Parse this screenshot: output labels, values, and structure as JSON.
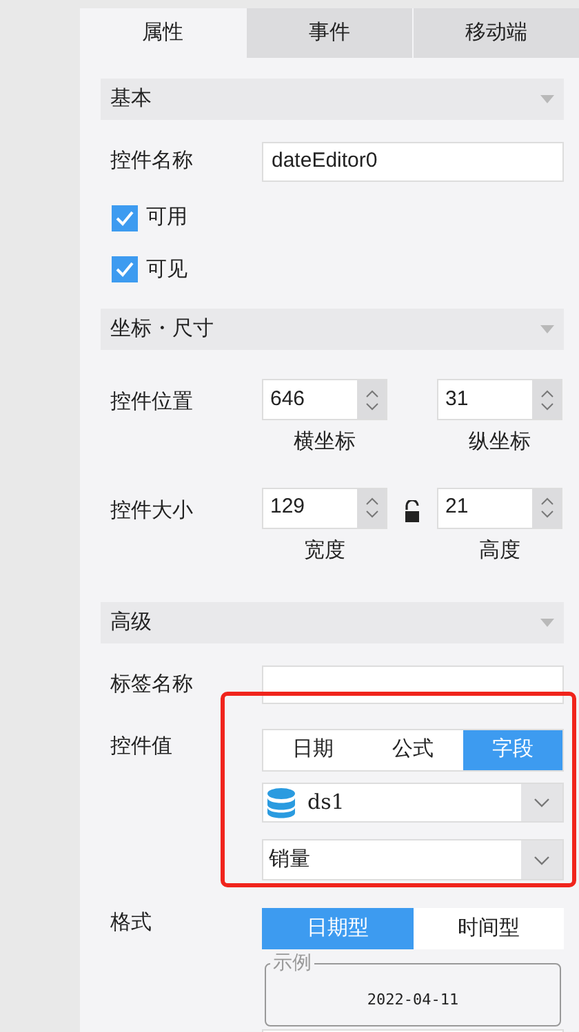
{
  "tabs": [
    {
      "label": "属性",
      "selected": true
    },
    {
      "label": "事件",
      "selected": false
    },
    {
      "label": "移动端",
      "selected": false
    }
  ],
  "basic": {
    "title": "基本",
    "expanded": true,
    "name_label": "控件名称",
    "name_value": "dateEditor0",
    "checkboxes": [
      {
        "label": "可用",
        "checked": true
      },
      {
        "label": "可见",
        "checked": true
      }
    ]
  },
  "geometry": {
    "title": "坐标・尺寸",
    "expanded": true,
    "rows": [
      {
        "label": "控件位置",
        "fields": [
          {
            "value": "646",
            "caption": "横坐标"
          },
          {
            "value": "31",
            "caption": "纵坐标"
          }
        ],
        "lock": false
      },
      {
        "label": "控件大小",
        "fields": [
          {
            "value": "129",
            "caption": "宽度"
          },
          {
            "value": "21",
            "caption": "高度"
          }
        ],
        "lock": true
      }
    ]
  },
  "advanced": {
    "title": "高级",
    "expanded": true,
    "tag_label": "标签名称",
    "value_label": "控件值",
    "value_modes": [
      {
        "label": "日期",
        "selected": false
      },
      {
        "label": "公式",
        "selected": false
      },
      {
        "label": "字段",
        "selected": true
      }
    ],
    "dataset": "ds1",
    "field": "销量",
    "highlighted": true,
    "format_label": "格式",
    "format_modes": [
      {
        "label": "日期型",
        "selected": true
      },
      {
        "label": "时间型",
        "selected": false
      }
    ],
    "example_legend": "示例",
    "example_value": "2022-04-11"
  }
}
